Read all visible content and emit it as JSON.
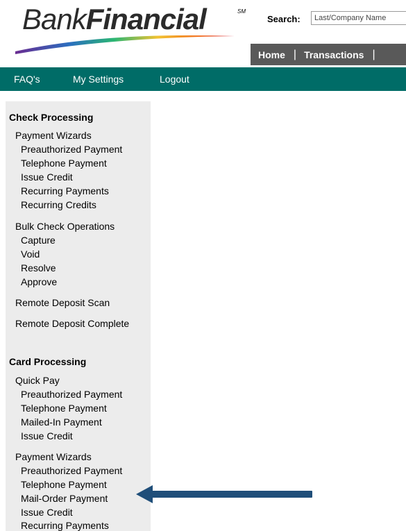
{
  "logo": {
    "word1": "Bank",
    "word2": "Financial",
    "mark": "SM"
  },
  "search": {
    "label": "Search:",
    "placeholder": "Last/Company Name"
  },
  "top_nav": {
    "home": "Home",
    "sep": "|",
    "transactions": "Transactions",
    "sep2": "|"
  },
  "menu": {
    "faq": "FAQ's",
    "settings": "My Settings",
    "logout": "Logout"
  },
  "sidebar": {
    "check_title": "Check Processing",
    "check_wizards": "Payment Wizards",
    "check_wizard_items": [
      "Preauthorized Payment",
      "Telephone Payment",
      "Issue Credit",
      "Recurring Payments",
      "Recurring Credits"
    ],
    "bulk": "Bulk Check Operations",
    "bulk_items": [
      "Capture",
      "Void",
      "Resolve",
      "Approve"
    ],
    "rds": "Remote Deposit Scan",
    "rdc": "Remote Deposit Complete",
    "card_title": "Card Processing",
    "quick_pay": "Quick Pay",
    "quick_pay_items": [
      "Preauthorized Payment",
      "Telephone Payment",
      "Mailed-In Payment",
      "Issue Credit"
    ],
    "card_wizards": "Payment Wizards",
    "card_wizard_items": [
      "Preauthorized Payment",
      "Telephone Payment",
      "Mail-Order Payment",
      "Issue Credit",
      "Recurring Payments"
    ]
  },
  "colors": {
    "menubar": "#006c67",
    "topnav": "#595959",
    "sidebar": "#ececec",
    "arrow": "#1f4e79"
  },
  "annotation": {
    "icon": "arrow-left-icon"
  }
}
